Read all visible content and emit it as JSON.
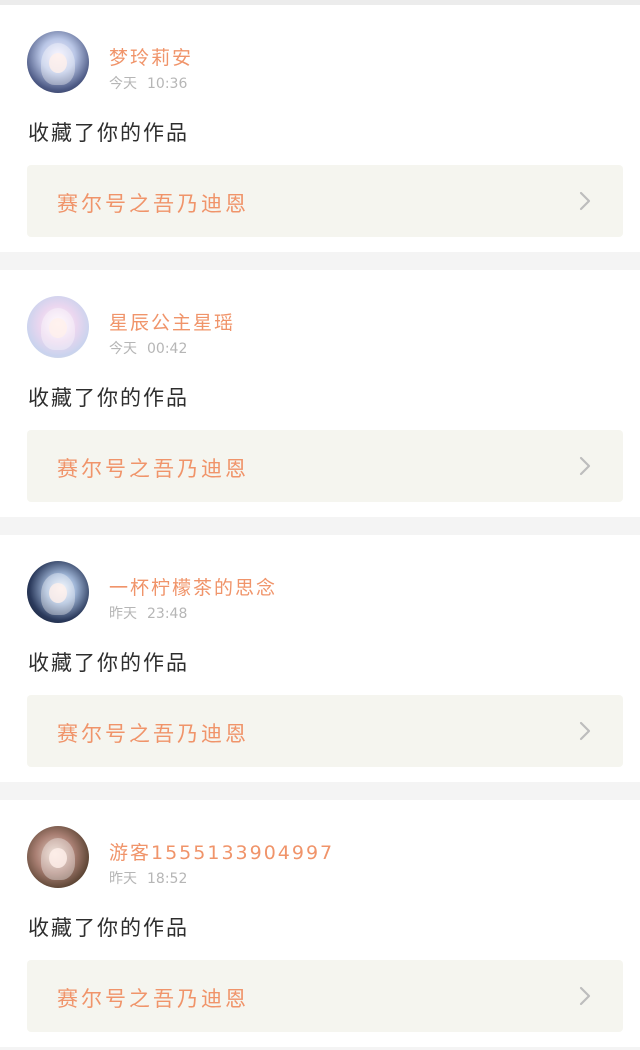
{
  "notifications": [
    {
      "name": "梦玲莉安",
      "day": "今天",
      "time": "10:36",
      "action": "收藏了你的作品",
      "work_title": "赛尔号之吾乃迪恩"
    },
    {
      "name": "星辰公主星瑶",
      "day": "今天",
      "time": "00:42",
      "action": "收藏了你的作品",
      "work_title": "赛尔号之吾乃迪恩"
    },
    {
      "name": "一杯柠檬茶的思念",
      "day": "昨天",
      "time": "23:48",
      "action": "收藏了你的作品",
      "work_title": "赛尔号之吾乃迪恩"
    },
    {
      "name": "游客1555133904997",
      "day": "昨天",
      "time": "18:52",
      "action": "收藏了你的作品",
      "work_title": "赛尔号之吾乃迪恩"
    }
  ],
  "colors": {
    "accent": "#f0946a",
    "text": "#2e2e2e",
    "muted": "#b6b6b6",
    "work_bg": "#f5f5ef",
    "page_bg": "#f4f4f4"
  },
  "icons": {
    "chevron": "chevron-right-icon"
  }
}
